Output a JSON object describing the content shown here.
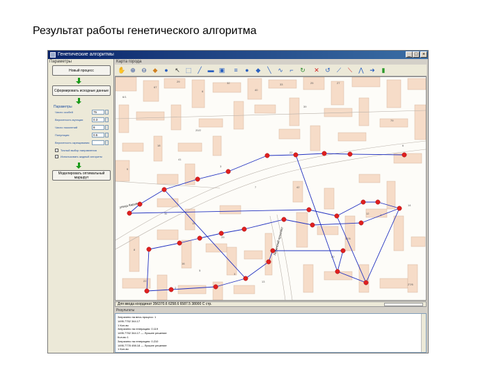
{
  "slide": {
    "title": "Результат работы генетического алгоритма"
  },
  "window": {
    "title": "Генетические алгоритмы",
    "minimize": "_",
    "maximize": "□",
    "close": "×"
  },
  "left_panel": {
    "tab": "Параметры",
    "buttons": [
      {
        "label": "Новый процесс"
      },
      {
        "label": "Сформировать исходные данные"
      },
      {
        "label": "Моделировать оптимальный маршрут"
      }
    ],
    "params_title": "Параметры",
    "params": [
      {
        "label": "Число особей",
        "value": "75"
      },
      {
        "label": "Вероятность мутации",
        "value": "0.3"
      },
      {
        "label": "Число поколений",
        "value": "8"
      },
      {
        "label": "Популяция",
        "value": "0.5"
      },
      {
        "label": "Вероятность скрещивания",
        "value": ""
      }
    ],
    "checkboxes": [
      {
        "label": "Точный выбор направления"
      },
      {
        "label": "Использовать жадный алгоритм"
      }
    ]
  },
  "map_panel": {
    "tab": "Карта города",
    "tools": [
      {
        "icon": "pan-icon",
        "glyph": "✋",
        "color": "#333333"
      },
      {
        "icon": "zoom-in-icon",
        "glyph": "⊕",
        "color": "#2a4a9a"
      },
      {
        "icon": "zoom-out-icon",
        "glyph": "⊖",
        "color": "#2a4a9a"
      },
      {
        "icon": "layers-icon",
        "glyph": "◆",
        "color": "#d08020"
      },
      {
        "icon": "globe-icon",
        "glyph": "●",
        "color": "#2a60c0"
      },
      {
        "icon": "select-icon",
        "glyph": "↖",
        "color": "#333333"
      },
      {
        "icon": "select-box-icon",
        "glyph": "⬚",
        "color": "#2a60c0"
      },
      {
        "icon": "measure-icon",
        "glyph": "╱",
        "color": "#2a60c0"
      },
      {
        "icon": "print-icon",
        "glyph": "▬",
        "color": "#2a60c0"
      },
      {
        "icon": "export-icon",
        "glyph": "▣",
        "color": "#2a60c0"
      },
      {
        "icon": "stack-icon",
        "glyph": "≡",
        "color": "#2a60c0"
      },
      {
        "icon": "add-point-icon",
        "glyph": "●",
        "color": "#2a60c0"
      },
      {
        "icon": "add-node-icon",
        "glyph": "◆",
        "color": "#2a60c0"
      },
      {
        "icon": "draw-line-icon",
        "glyph": "╲",
        "color": "#2a60c0"
      },
      {
        "icon": "draw-polyline-icon",
        "glyph": "∿",
        "color": "#2a60c0"
      },
      {
        "icon": "edit-line-icon",
        "glyph": "⌐",
        "color": "#2a60c0"
      },
      {
        "icon": "refresh-icon",
        "glyph": "↻",
        "color": "#2a8a2a"
      },
      {
        "icon": "delete-icon",
        "glyph": "✕",
        "color": "#d02020"
      },
      {
        "icon": "clear-icon",
        "glyph": "↺",
        "color": "#2a60c0"
      },
      {
        "icon": "route-icon",
        "glyph": "⟋",
        "color": "#2a60c0"
      },
      {
        "icon": "route-edit-icon",
        "glyph": "⟍",
        "color": "#d02020"
      },
      {
        "icon": "graph-icon",
        "glyph": "⋀",
        "color": "#2a60c0"
      },
      {
        "icon": "forward-icon",
        "glyph": "➜",
        "color": "#2a60c0"
      },
      {
        "icon": "chart-icon",
        "glyph": "▮",
        "color": "#2a9a2a"
      }
    ],
    "map_labels": [
      "6/1",
      "67",
      "29",
      "6",
      "32",
      "40",
      "33",
      "25",
      "27",
      "20/2",
      "39",
      "18",
      "41",
      "3",
      "9",
      "79",
      "6",
      "22",
      "7",
      "11",
      "15",
      "29",
      "8",
      "16",
      "5",
      "3",
      "42",
      "17/5",
      "12",
      "14",
      "22",
      "2",
      "13",
      "20",
      "27/6",
      "1"
    ],
    "street_labels": [
      "улица Кирова",
      "Ленинский проспект"
    ],
    "route": {
      "line_color": "#2030c0",
      "point_color": "#e02020"
    }
  },
  "status": {
    "coords": "Для ввода координат 356370.6 6258.6 6587.5 38000 С  стр."
  },
  "results": {
    "label": "Результаты",
    "log": [
      "Затрачено на весь процесс: 1",
      "1495.7752 344.17",
      "1 Кол-во",
      "Затрачено на генерацию: 0.119",
      "1495.7752 344.17 — Лучшее решение",
      "Кол-во 1",
      "Затрачено на генерацию: 0.210",
      "1495.7778 498.18 — Лучшее решение",
      "1 Кол-во"
    ]
  }
}
